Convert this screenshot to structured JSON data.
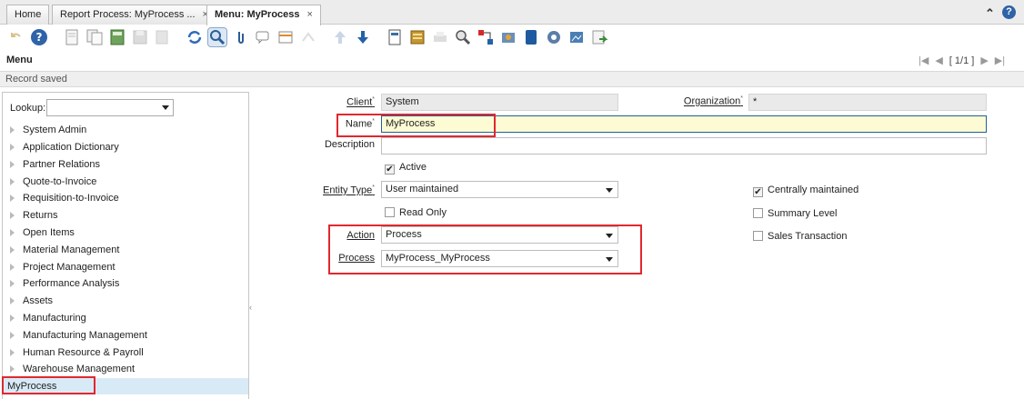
{
  "tabs": [
    {
      "label": "Home",
      "closable": false
    },
    {
      "label": "Report Process: MyProcess ...",
      "closable": true
    },
    {
      "label": "Menu: MyProcess",
      "closable": true,
      "active": true
    }
  ],
  "close_glyph": "×",
  "window": {
    "title": "Menu",
    "status": "Record saved",
    "record_nav": {
      "page": "[ 1/1 ]"
    }
  },
  "toolbar_icons": [
    "undo-icon",
    "help-icon",
    "new-record-icon",
    "copy-record-icon",
    "delete-icon",
    "save-icon",
    "print-preview-icon",
    "refresh-icon",
    "find-icon",
    "attachment-icon",
    "chat-icon",
    "grid-toggle-icon",
    "history-icon",
    "parent-record-icon",
    "detail-record-icon",
    "report-icon",
    "archive-icon",
    "print-icon",
    "zoom-across-icon",
    "workflow-icon",
    "request-icon",
    "product-info-icon",
    "archived-docs-icon",
    "process-icon",
    "export-icon",
    "end-icon"
  ],
  "sidebar": {
    "lookup_label": "Lookup:",
    "items": [
      "System Admin",
      "Application Dictionary",
      "Partner Relations",
      "Quote-to-Invoice",
      "Requisition-to-Invoice",
      "Returns",
      "Open Items",
      "Material Management",
      "Project Management",
      "Performance Analysis",
      "Assets",
      "Manufacturing",
      "Manufacturing Management",
      "Human Resource & Payroll",
      "Warehouse Management"
    ],
    "selected": "MyProcess"
  },
  "form": {
    "client": {
      "label": "Client",
      "value": "System"
    },
    "organization": {
      "label": "Organization",
      "value": "*"
    },
    "name": {
      "label": "Name",
      "value": "MyProcess"
    },
    "description": {
      "label": "Description",
      "value": ""
    },
    "active": {
      "label": "Active",
      "checked": true
    },
    "entity_type": {
      "label": "Entity Type",
      "value": "User maintained"
    },
    "centrally_maintained": {
      "label": "Centrally maintained",
      "checked": true
    },
    "read_only": {
      "label": "Read Only",
      "checked": false
    },
    "summary_level": {
      "label": "Summary Level",
      "checked": false
    },
    "action": {
      "label": "Action",
      "value": "Process"
    },
    "sales_transaction": {
      "label": "Sales Transaction",
      "checked": false
    },
    "process": {
      "label": "Process",
      "value": "MyProcess_MyProcess"
    },
    "required_marker": "*"
  },
  "colors": {
    "highlight": "#e0282e",
    "selection": "#d9eaf7",
    "required_field": "#fdfbd4"
  }
}
